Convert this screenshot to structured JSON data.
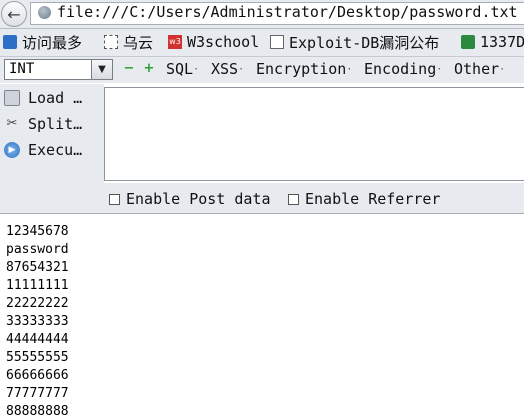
{
  "address_bar": {
    "url": "file:///C:/Users/Administrator/Desktop/password.txt"
  },
  "bookmarks": [
    {
      "label": "访问最多",
      "icon": "search-icon"
    },
    {
      "label": "乌云",
      "icon": "dashed-box-icon"
    },
    {
      "label": "W3school",
      "icon": "w3-icon"
    },
    {
      "label": "Exploit-DB漏洞公布",
      "icon": "page-icon"
    },
    {
      "label": "1337D",
      "icon": "skull-icon"
    }
  ],
  "hackbar": {
    "select_value": "INT",
    "decrease_label": "−",
    "increase_label": "+",
    "menus": [
      "SQL",
      "XSS",
      "Encryption",
      "Encoding",
      "Other"
    ],
    "actions": [
      "Load …",
      "Split…",
      "Execu…"
    ],
    "options": [
      "Enable Post data",
      "Enable Referrer"
    ]
  },
  "content": {
    "lines": [
      "12345678",
      "password",
      "87654321",
      "11111111",
      "22222222",
      "33333333",
      "44444444",
      "55555555",
      "66666666",
      "77777777",
      "88888888"
    ]
  }
}
